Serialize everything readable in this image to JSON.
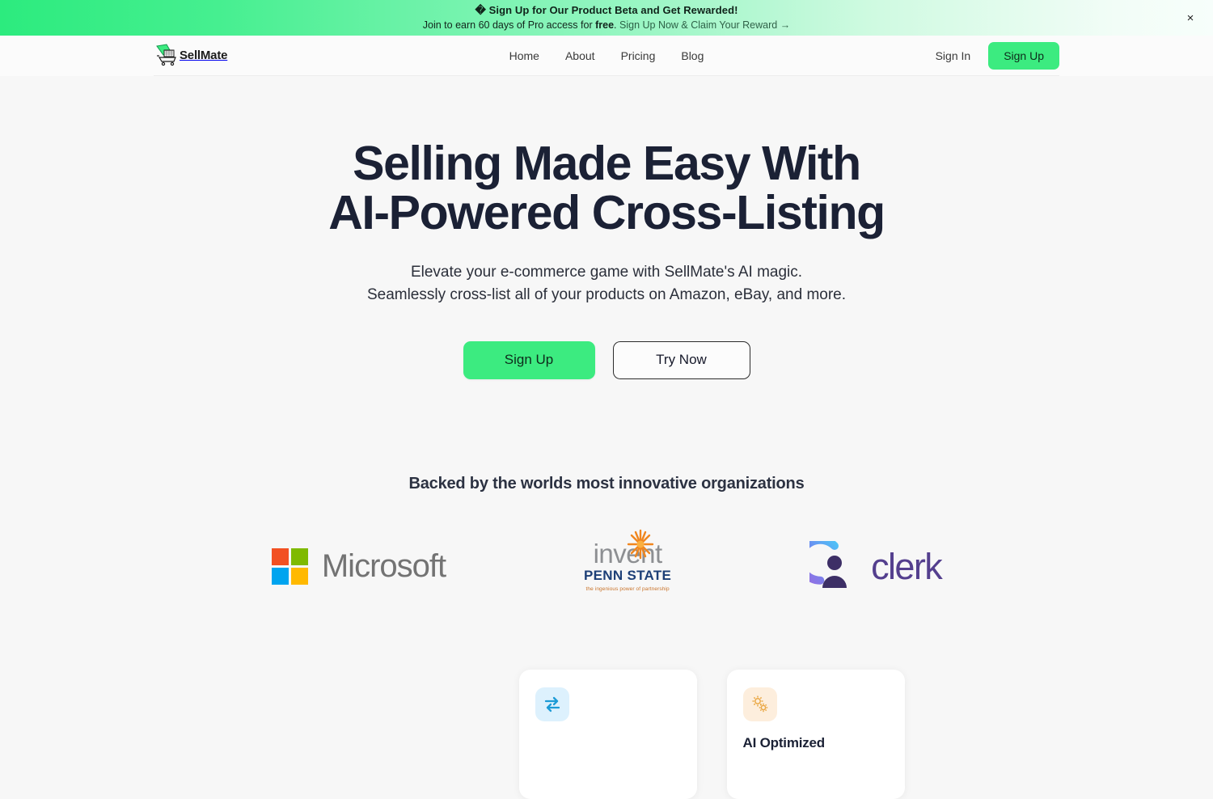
{
  "banner": {
    "emoji": "�",
    "line1": "Sign Up for Our Product Beta and Get Rewarded!",
    "line2_prefix": "Join to earn 60 days of Pro access for ",
    "line2_bold": "free",
    "line2_suffix": ".",
    "link": "Sign Up Now & Claim Your Reward →",
    "close": "×"
  },
  "header": {
    "logo_text": "SellMate",
    "nav": [
      {
        "label": "Home"
      },
      {
        "label": "About"
      },
      {
        "label": "Pricing"
      },
      {
        "label": "Blog"
      }
    ],
    "sign_in": "Sign In",
    "sign_up": "Sign Up"
  },
  "hero": {
    "title_line1": "Selling Made Easy With",
    "title_line2": "AI-Powered Cross-Listing",
    "sub_line1": "Elevate your e-commerce game with SellMate's AI magic.",
    "sub_line2": "Seamlessly cross-list all of your products on Amazon, eBay, and more.",
    "primary_cta": "Sign Up",
    "secondary_cta": "Try Now"
  },
  "partners": {
    "title": "Backed by the worlds most innovative organizations",
    "logos": [
      {
        "name": "Microsoft",
        "text": "Microsoft"
      },
      {
        "name": "invent Penn State",
        "invent": "invent",
        "penn": "PENN STATE",
        "tagline": "the ingenious power of partnership"
      },
      {
        "name": "Clerk",
        "text": "clerk"
      }
    ]
  },
  "cards": [
    {
      "title": ""
    },
    {
      "title": "AI Optimized"
    }
  ],
  "colors": {
    "accent_green": "#3ceb80",
    "banner_green": "#2ceb7e",
    "heading_navy": "#1b2135",
    "page_bg": "#f7f7f7",
    "ms_red": "#f25022",
    "ms_green": "#7fba00",
    "ms_blue": "#00a4ef",
    "ms_yellow": "#ffb900",
    "penn_blue": "#1d3f77",
    "penn_orange": "#c9732a",
    "clerk_purple": "#543f8e"
  }
}
